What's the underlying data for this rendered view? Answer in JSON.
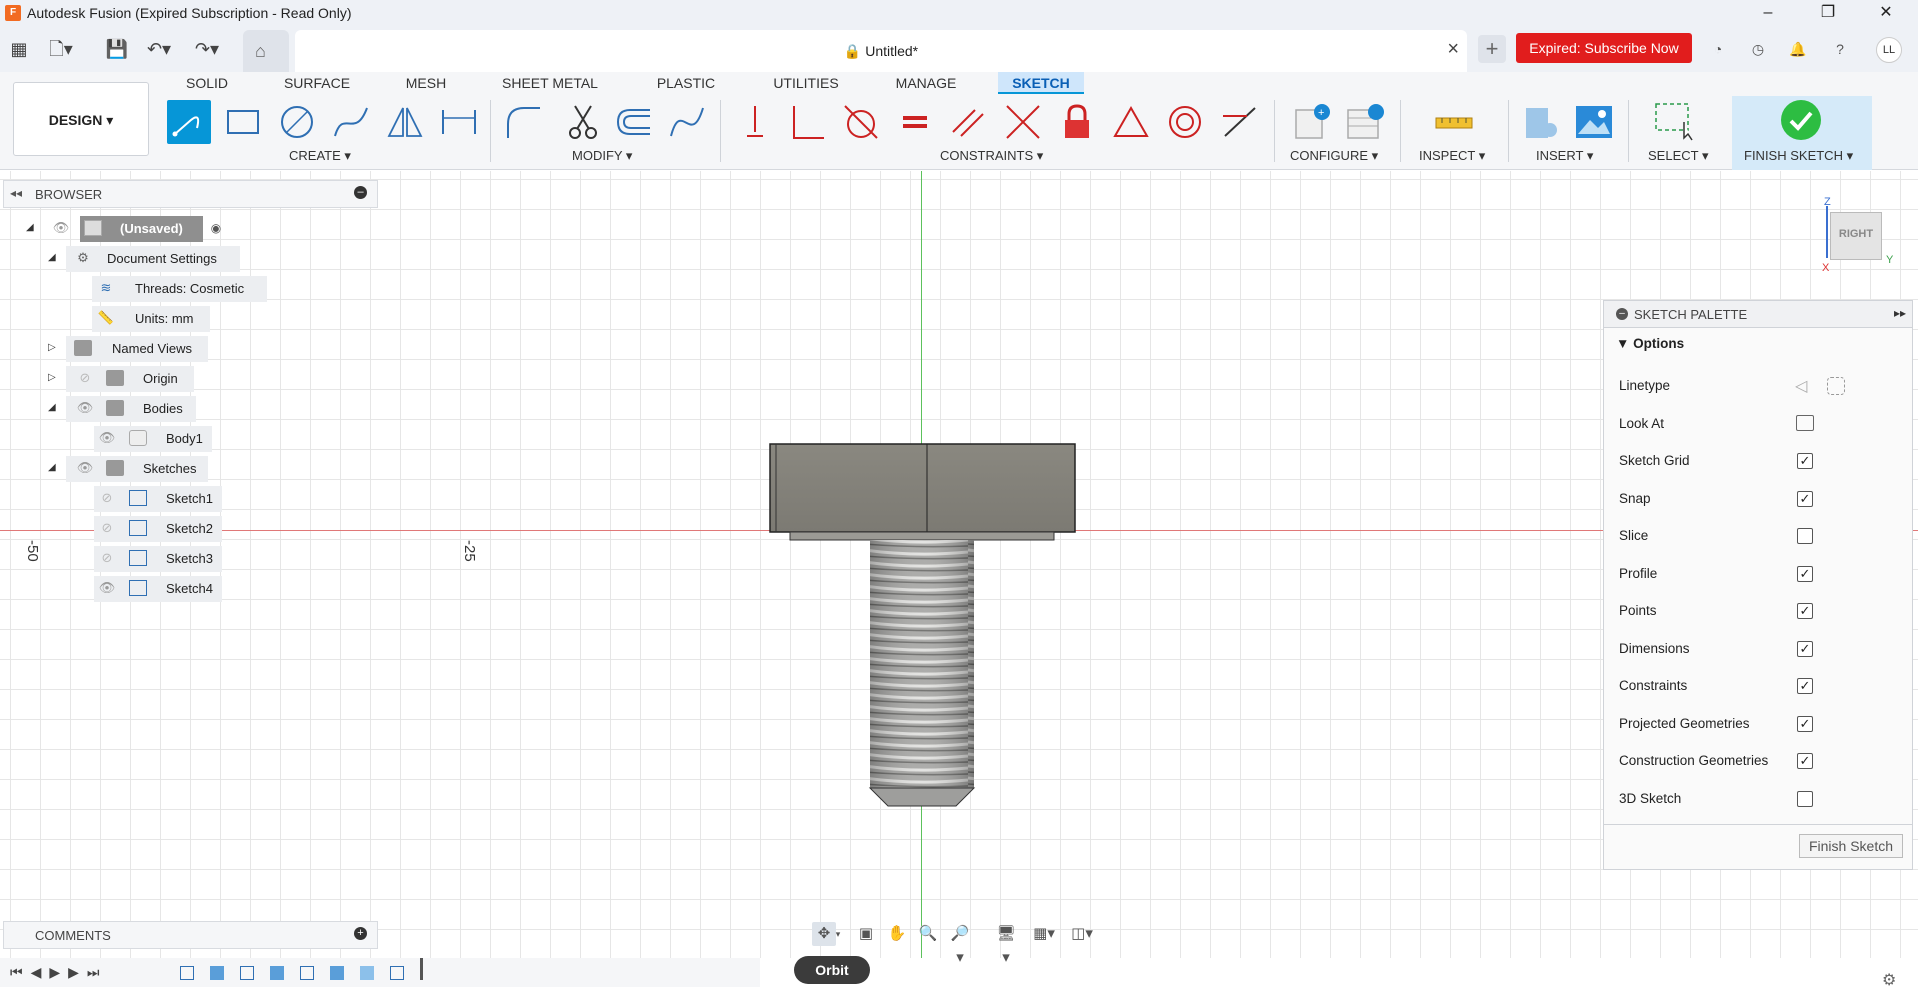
{
  "window": {
    "title": "Autodesk Fusion (Expired Subscription - Read Only)",
    "logo_letter": "F"
  },
  "document": {
    "tab_name": "Untitled*",
    "close_glyph": "×"
  },
  "appbar": {
    "subscribe_label": "Expired: Subscribe Now",
    "avatar_initials": "LL"
  },
  "workspace": {
    "design_label": "DESIGN ▾"
  },
  "ribbon_tabs": [
    "SOLID",
    "SURFACE",
    "MESH",
    "SHEET METAL",
    "PLASTIC",
    "UTILITIES",
    "MANAGE",
    "SKETCH"
  ],
  "ribbon_groups": {
    "create": "CREATE ▾",
    "modify": "MODIFY ▾",
    "constraints": "CONSTRAINTS ▾",
    "configure": "CONFIGURE ▾",
    "inspect": "INSPECT ▾",
    "insert": "INSERT ▾",
    "select": "SELECT ▾",
    "finish": "FINISH SKETCH ▾"
  },
  "browser": {
    "title": "BROWSER",
    "items": [
      {
        "label": "(Unsaved)"
      },
      {
        "label": "Document Settings"
      },
      {
        "label": "Threads: Cosmetic"
      },
      {
        "label": "Units: mm"
      },
      {
        "label": "Named Views"
      },
      {
        "label": "Origin"
      },
      {
        "label": "Bodies"
      },
      {
        "label": "Body1"
      },
      {
        "label": "Sketches"
      },
      {
        "label": "Sketch1"
      },
      {
        "label": "Sketch2"
      },
      {
        "label": "Sketch3"
      },
      {
        "label": "Sketch4"
      }
    ]
  },
  "viewport": {
    "ruler_labels": [
      "-50",
      "-25"
    ],
    "viewcube": {
      "face": "RIGHT",
      "z": "Z",
      "y": "Y",
      "x": "X"
    }
  },
  "sketch_palette": {
    "title": "SKETCH PALETTE",
    "section": "Options",
    "rows": [
      {
        "label": "Linetype"
      },
      {
        "label": "Look At"
      },
      {
        "label": "Sketch Grid",
        "checked": true
      },
      {
        "label": "Snap",
        "checked": true
      },
      {
        "label": "Slice",
        "checked": false
      },
      {
        "label": "Profile",
        "checked": true
      },
      {
        "label": "Points",
        "checked": true
      },
      {
        "label": "Dimensions",
        "checked": true
      },
      {
        "label": "Constraints",
        "checked": true
      },
      {
        "label": "Projected Geometries",
        "checked": true
      },
      {
        "label": "Construction Geometries",
        "checked": true
      },
      {
        "label": "3D Sketch",
        "checked": false
      }
    ],
    "finish_button": "Finish Sketch"
  },
  "comments": {
    "title": "COMMENTS"
  },
  "tooltip": {
    "orbit": "Orbit"
  },
  "colors": {
    "accent": "#0696d7",
    "subscribe": "#e11d1d",
    "finish_check": "#2dbd42"
  }
}
